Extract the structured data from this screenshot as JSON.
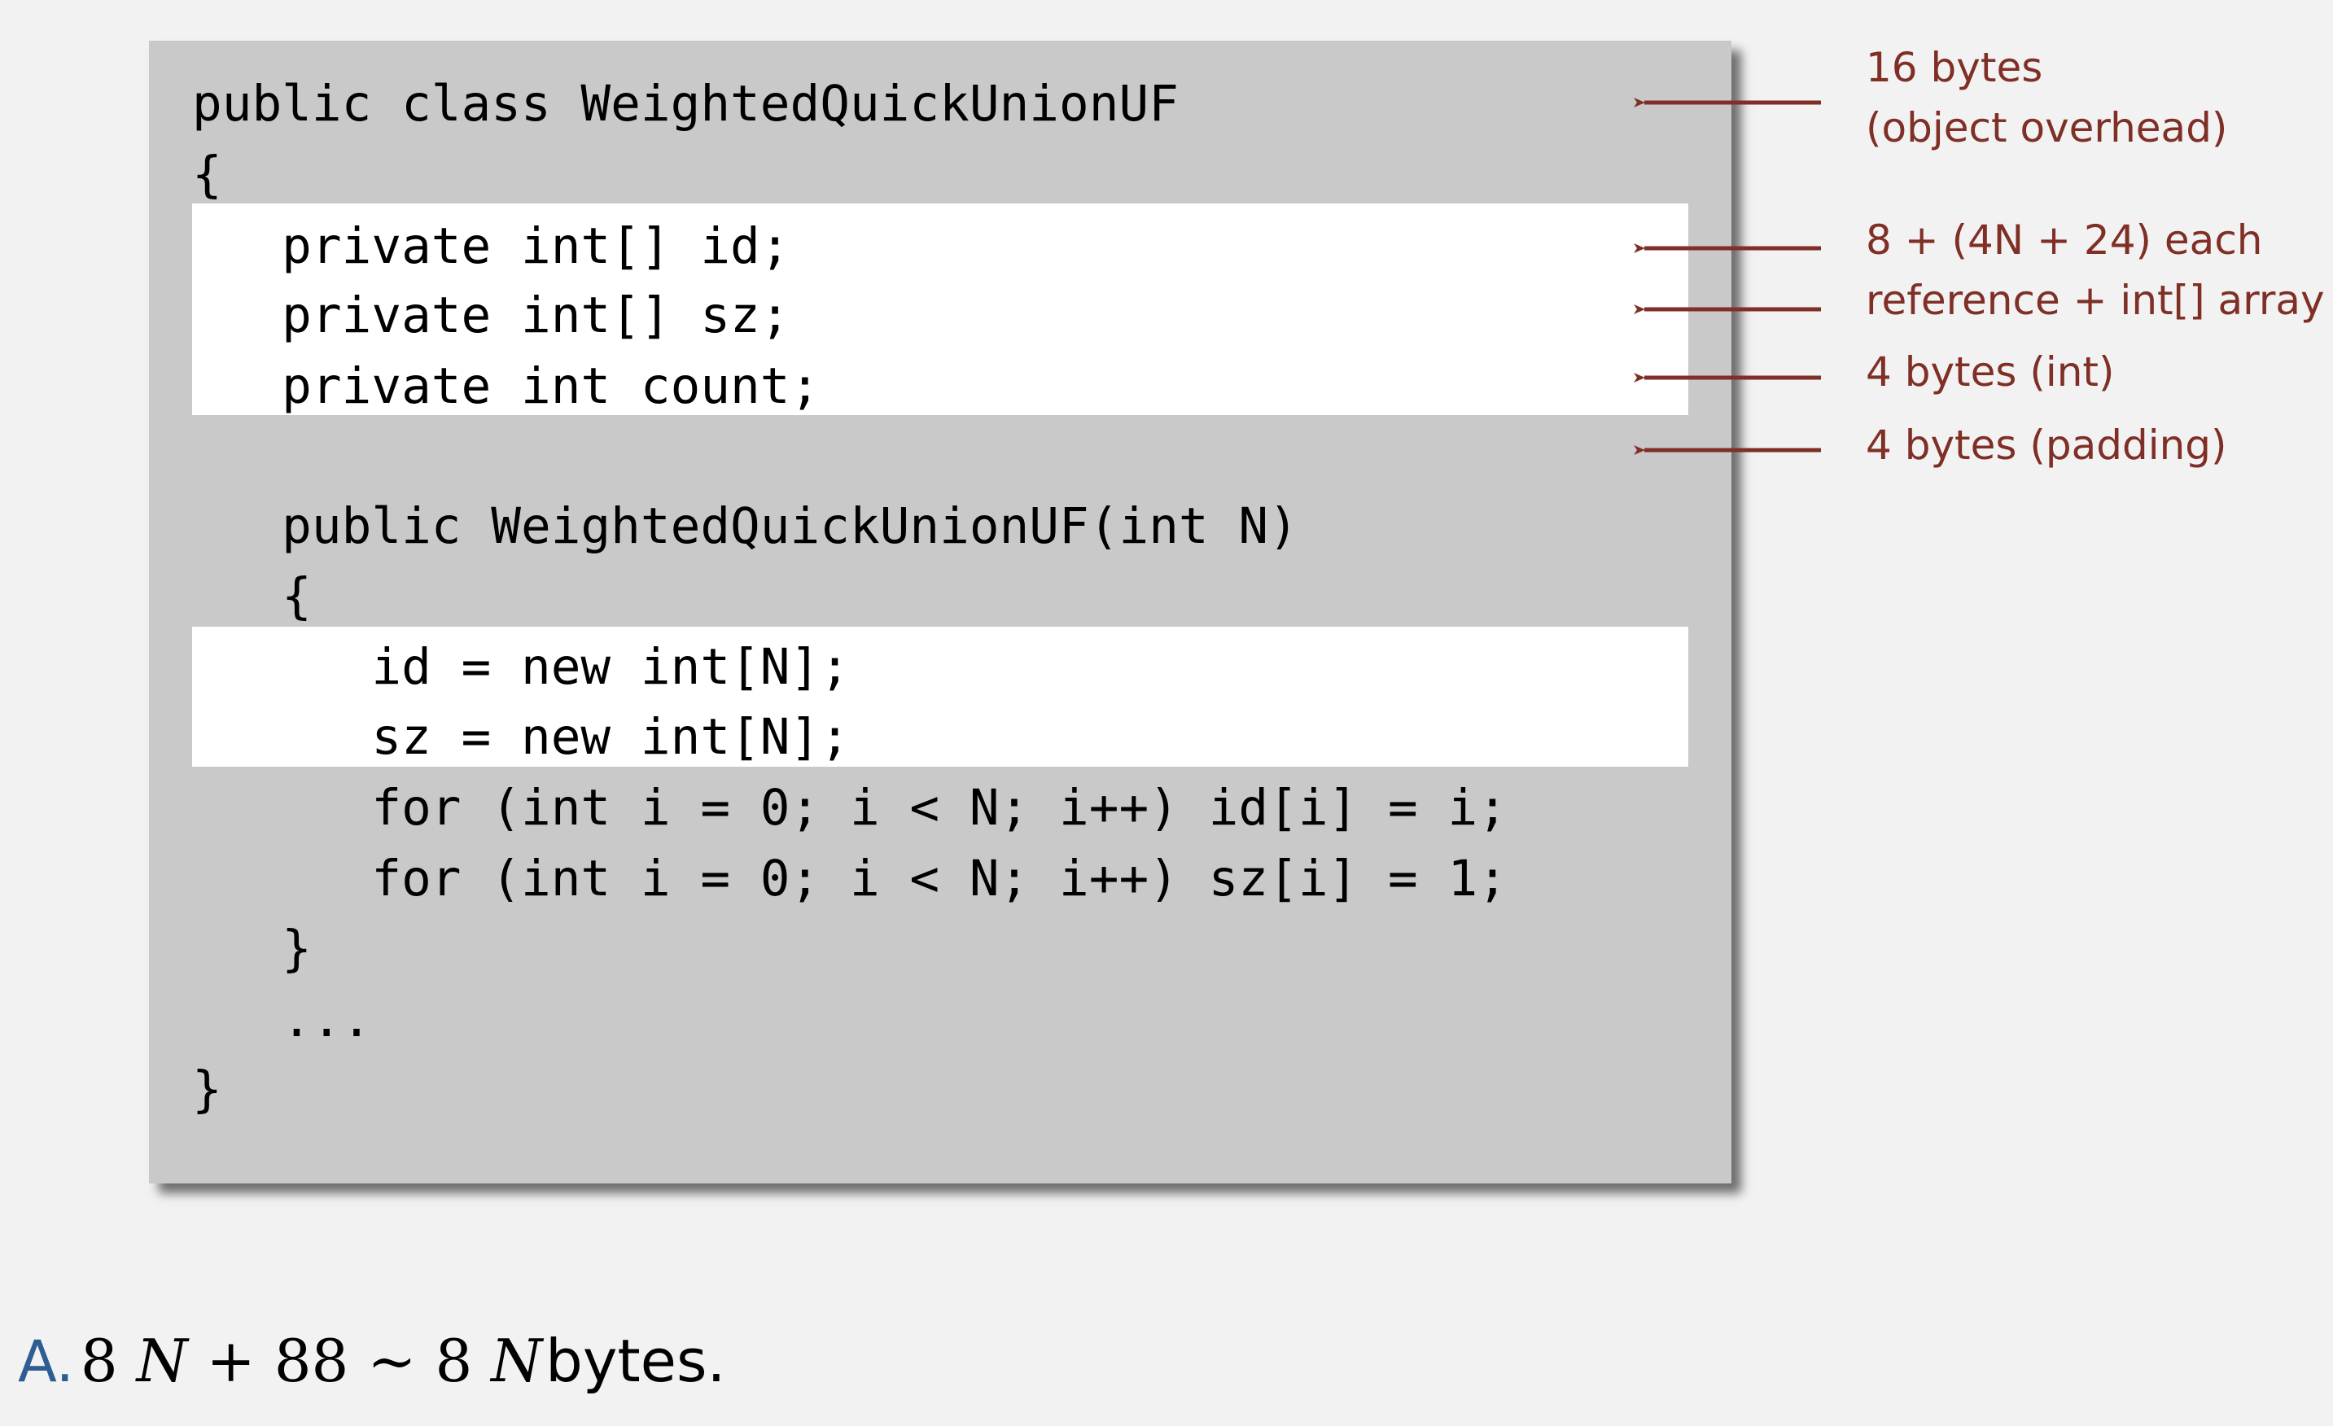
{
  "code_lines": [
    "public class WeightedQuickUnionUF",
    "{",
    "   private int[] id;",
    "   private int[] sz;",
    "   private int count;",
    "",
    "   public WeightedQuickUnionUF(int N)",
    "   {",
    "      id = new int[N];",
    "      sz = new int[N];",
    "      for (int i = 0; i < N; i++) id[i] = i;",
    "      for (int i = 0; i < N; i++) sz[i] = 1;",
    "   }",
    "   ...",
    "}"
  ],
  "annotations": {
    "overhead": [
      "16 bytes",
      "(object overhead)"
    ],
    "arrays": [
      "8 + (4N + 24) each",
      "reference + int[] array"
    ],
    "int_field": "4 bytes (int)",
    "padding": "4 bytes (padding)"
  },
  "answer": {
    "label": "A.",
    "formula_coef1": "8",
    "formula_var1": "N",
    "formula_plus": "+ 88 ~",
    "formula_coef2": "8",
    "formula_var2": "N",
    "unit": "bytes."
  },
  "colors": {
    "panel": "#c9c9c9",
    "highlight": "#ffffff",
    "annotation": "#7f2f26",
    "answer_label": "#2e5d93",
    "background": "#f2f2f2"
  }
}
